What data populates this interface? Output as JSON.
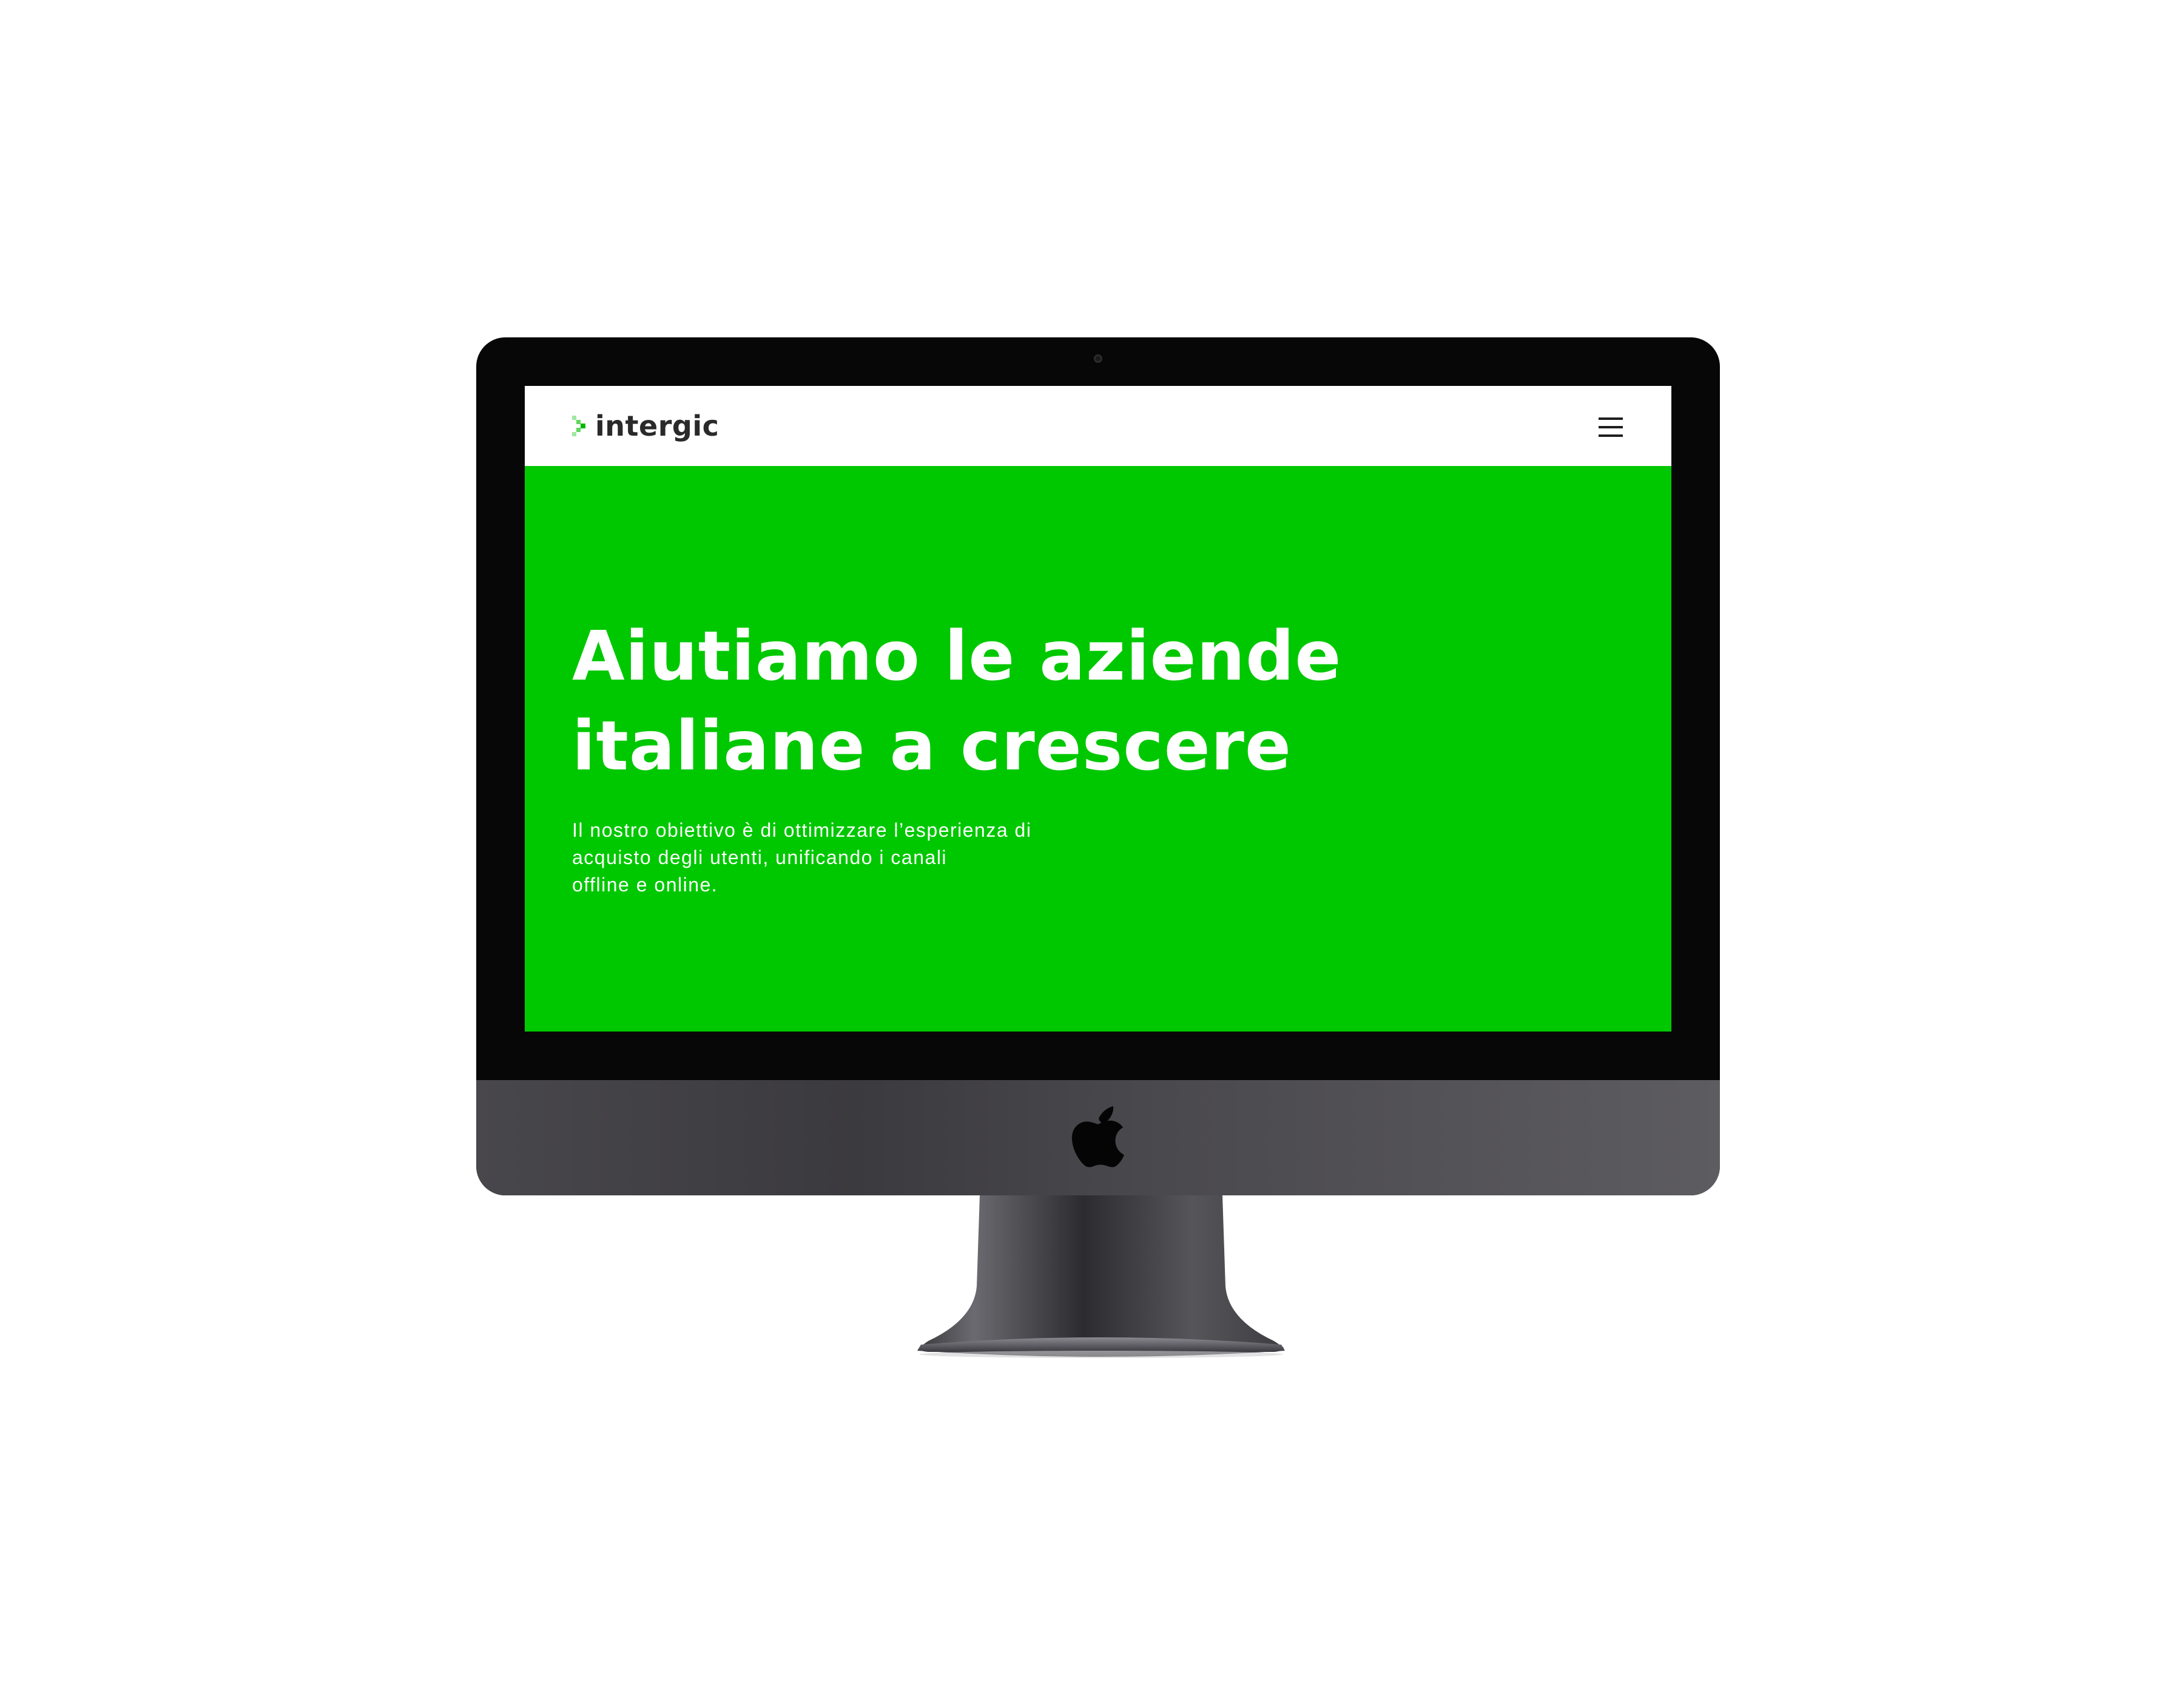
{
  "device": {
    "type": "desktop-monitor",
    "icons": {
      "camera": "camera-icon",
      "brand": "apple-logo-icon"
    }
  },
  "site": {
    "header": {
      "logo_text": "intergic",
      "logo_icon": "chevron-right-icon",
      "menu_icon": "hamburger-menu-icon"
    },
    "hero": {
      "title_line1": "Aiutiamo le aziende",
      "title_line2": "italiane a crescere",
      "text_line1": "Il nostro obiettivo è di ottimizzare l’esperienza di",
      "text_line2": "acquisto degli utenti, unificando i canali",
      "text_line3": "offline e online."
    }
  },
  "colors": {
    "hero_background": "#00c800",
    "header_background": "#ffffff",
    "logo_text": "#2a2a2a",
    "hero_text": "#ffffff",
    "bezel": "#070707",
    "chin": "#48474c"
  }
}
